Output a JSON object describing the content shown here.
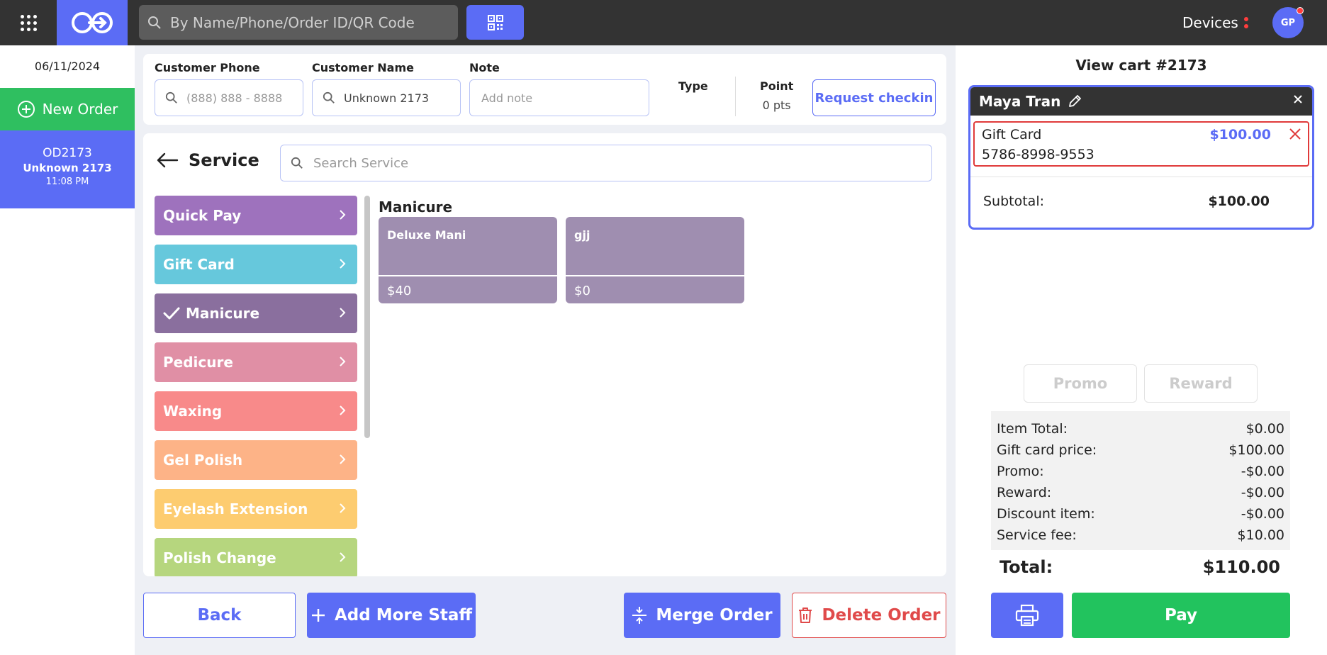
{
  "topbar": {
    "search_placeholder": "By Name/Phone/Order ID/QR Code",
    "devices_label": "Devices",
    "avatar_initials": "GP"
  },
  "sidebar": {
    "date": "06/11/2024",
    "new_order_label": "New Order",
    "orders": [
      {
        "id": "OD2173",
        "name": "Unknown 2173",
        "time": "11:08 PM"
      }
    ]
  },
  "customer": {
    "phone_label": "Customer Phone",
    "phone_placeholder": "(888) 888 - 8888",
    "name_label": "Customer Name",
    "name_value": "Unknown 2173",
    "note_label": "Note",
    "note_placeholder": "Add note",
    "type_label": "Type",
    "point_label": "Point",
    "point_value": "0 pts",
    "request_checkin_label": "Request checkin"
  },
  "service": {
    "title": "Service",
    "search_placeholder": "Search Service",
    "categories": [
      {
        "label": "Quick Pay",
        "color": "#9e72bd",
        "selected": false
      },
      {
        "label": "Gift Card",
        "color": "#66c8dc",
        "selected": false
      },
      {
        "label": "Manicure",
        "color": "#8a6f9e",
        "selected": true
      },
      {
        "label": "Pedicure",
        "color": "#e08fa5",
        "selected": false
      },
      {
        "label": "Waxing",
        "color": "#f88a8a",
        "selected": false
      },
      {
        "label": "Gel Polish",
        "color": "#fdb387",
        "selected": false
      },
      {
        "label": "Eyelash Extension",
        "color": "#fdcc70",
        "selected": false
      },
      {
        "label": "Polish Change",
        "color": "#b6d67e",
        "selected": false
      }
    ],
    "group_title": "Manicure",
    "items": [
      {
        "name": "Deluxe Mani",
        "price": "$40"
      },
      {
        "name": "gjj",
        "price": "$0"
      }
    ]
  },
  "actions": {
    "back_label": "Back",
    "add_staff_label": "Add More Staff",
    "merge_label": "Merge Order",
    "delete_label": "Delete Order"
  },
  "cart": {
    "title": "View cart #2173",
    "staff_name": "Maya Tran",
    "item_name": "Gift Card",
    "item_code": "5786-8998-9553",
    "item_price": "$100.00",
    "subtotal_label": "Subtotal:",
    "subtotal_value": "$100.00",
    "promo_label": "Promo",
    "reward_label": "Reward",
    "summary": [
      {
        "label": "Item Total:",
        "value": "$0.00"
      },
      {
        "label": "Gift card price:",
        "value": "$100.00"
      },
      {
        "label": "Promo:",
        "value": "-$0.00"
      },
      {
        "label": "Reward:",
        "value": "-$0.00"
      },
      {
        "label": "Discount item:",
        "value": "-$0.00"
      },
      {
        "label": "Service fee:",
        "value": "$10.00"
      }
    ],
    "total_label": "Total:",
    "total_value": "$110.00",
    "pay_label": "Pay"
  },
  "colors": {
    "accent": "#5b6cf5",
    "success": "#22c35e",
    "danger": "#e04a4a",
    "topbar": "#333333"
  },
  "icons": {
    "apps": "apps-grid-icon",
    "logo": "link-logo-icon",
    "search": "search-icon",
    "qr": "qr-code-icon",
    "menu": "vertical-dots-icon",
    "add": "plus-circle-icon",
    "back": "arrow-left-icon",
    "chevron": "chevron-right-icon",
    "check": "check-icon",
    "edit": "pencil-icon",
    "close": "close-icon",
    "merge": "merge-icon",
    "delete": "trash-icon",
    "print": "printer-icon"
  }
}
